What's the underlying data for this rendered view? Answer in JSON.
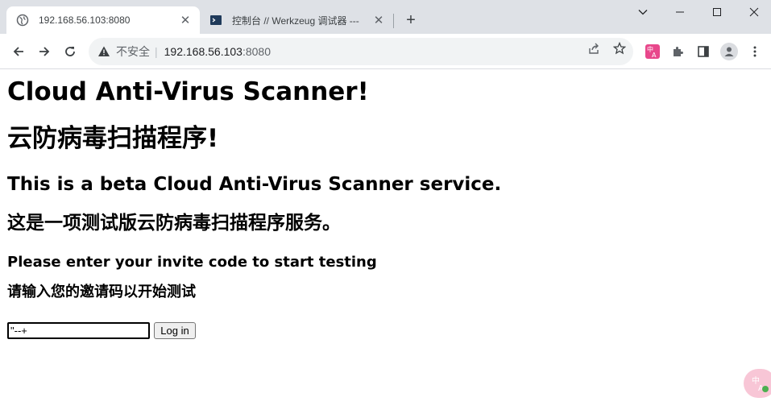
{
  "browser": {
    "tabs": [
      {
        "title": "192.168.56.103:8080",
        "favicon": "globe-icon",
        "active": true
      },
      {
        "title": "控制台 // Werkzeug 调试器 ---",
        "favicon": "terminal-icon",
        "active": false
      }
    ],
    "address": {
      "security_label": "不安全",
      "host": "192.168.56.103",
      "port": ":8080"
    }
  },
  "page": {
    "title_en": "Cloud Anti-Virus Scanner!",
    "title_zh": "云防病毒扫描程序!",
    "subtitle_en": "This is a beta Cloud Anti-Virus Scanner service.",
    "subtitle_zh": "这是一项测试版云防病毒扫描程序服务。",
    "prompt_en": "Please enter your invite code to start testing",
    "prompt_zh": "请输入您的邀请码以开始测试",
    "invite_code_value": "\"--+",
    "login_label": "Log in"
  },
  "colors": {
    "tabstrip_bg": "#dee1e6",
    "omnibox_bg": "#f1f3f4",
    "ext_accent": "#e8478b"
  }
}
